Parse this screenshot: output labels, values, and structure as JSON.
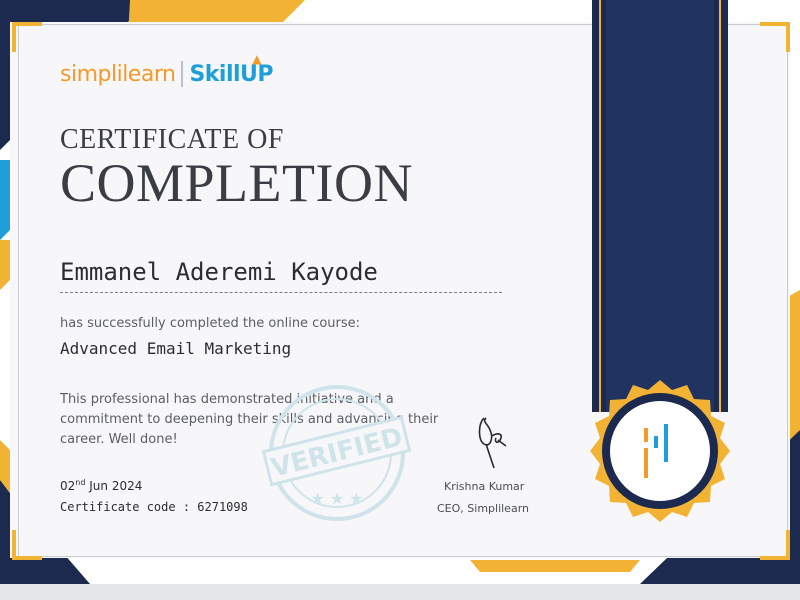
{
  "brand": {
    "logo_simpli": "simplilearn",
    "logo_skillup": "SkillUP"
  },
  "certificate": {
    "title_line1": "CERTIFICATE OF",
    "title_line2": "COMPLETION",
    "recipient_name": "Emmanel Aderemi Kayode",
    "completed_text": "has successfully completed the online course:",
    "course_name": "Advanced Email Marketing",
    "description": "This professional has demonstrated initiative and a commitment to deepening their skills and advancing their career. Well done!",
    "date_day": "02",
    "date_suffix": "nd",
    "date_rest": " Jun 2024",
    "code_label": "Certificate code : ",
    "code_value": "6271098",
    "stamp_text": "VERIFIED"
  },
  "signatory": {
    "name": "Krishna Kumar",
    "role": "CEO, Simplilearn"
  },
  "colors": {
    "navy": "#1b2a4e",
    "gold": "#f2b233",
    "orange": "#f59a2a",
    "sky": "#1e9fd9",
    "stamp": "#cfe3ea"
  }
}
